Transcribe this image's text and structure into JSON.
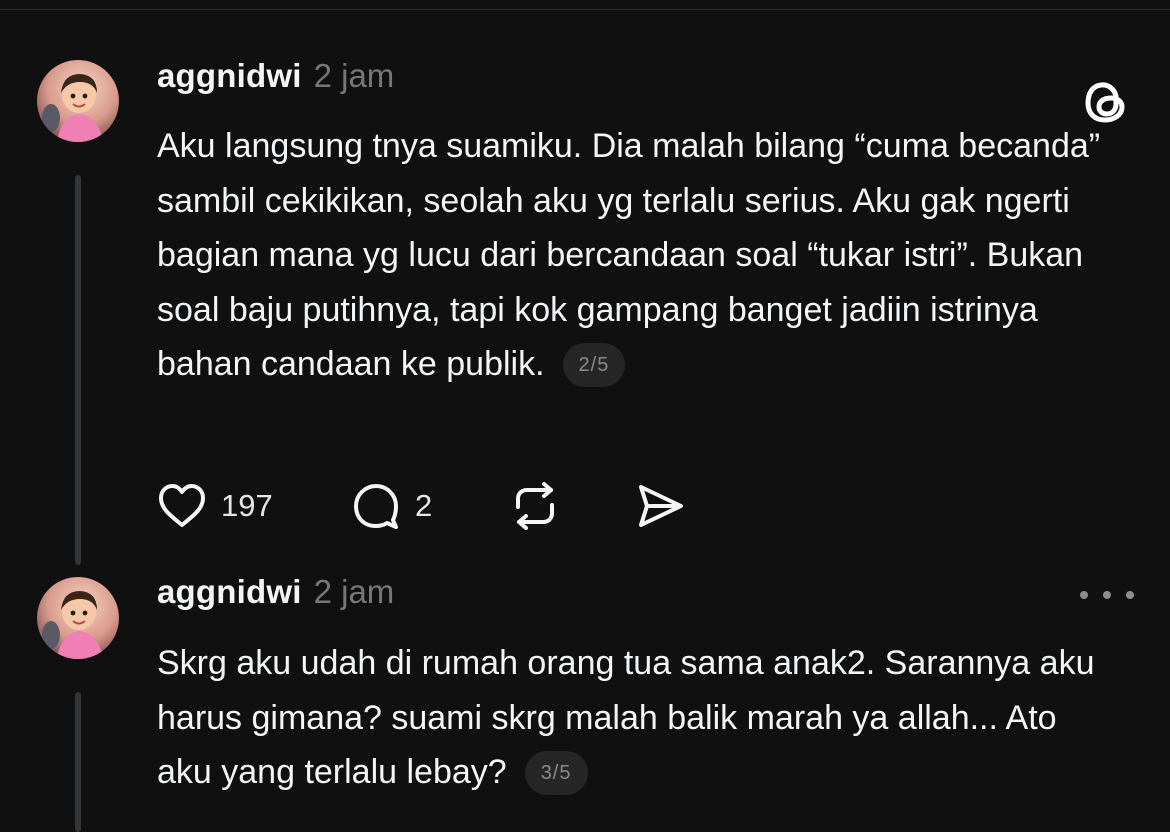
{
  "posts": [
    {
      "username": "aggnidwi",
      "timestamp": "2 jam",
      "text": "Aku langsung tnya suamiku. Dia malah bilang “cuma becanda” sambil cekikikan, seolah aku yg terlalu serius. Aku gak ngerti bagian mana yg lucu dari bercandaan soal “tukar istri”. Bukan soal baju putihnya, tapi kok gampang banget jadiin istrinya bahan candaan ke publik.",
      "page_badge": "2/5",
      "likes": "197",
      "replies": "2",
      "header_icon": "threads-logo-icon"
    },
    {
      "username": "aggnidwi",
      "timestamp": "2 jam",
      "text": "Skrg aku udah di rumah orang tua sama anak2. Sarannya aku harus gimana? suami skrg malah balik marah ya allah... Ato aku yang terlalu lebay?",
      "page_badge": "3/5",
      "header_icon": "more-options-icon"
    }
  ],
  "icons": {
    "like": "heart-icon",
    "reply": "comment-bubble-icon",
    "repost": "repost-icon",
    "share": "send-icon",
    "avatar": "user-avatar-image"
  },
  "colors": {
    "background": "#101010",
    "text_primary": "#f3f5f7",
    "text_secondary": "#777777",
    "thread_line": "#333638",
    "badge_bg": "#262626"
  }
}
